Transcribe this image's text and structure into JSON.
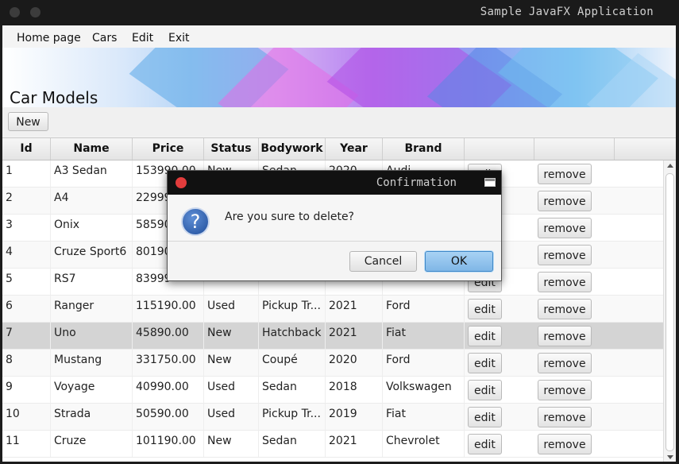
{
  "window": {
    "title": "Sample JavaFX Application"
  },
  "menu": [
    "Home page",
    "Cars",
    "Edit",
    "Exit"
  ],
  "banner": {
    "title": "Car Models"
  },
  "toolbar": {
    "new_label": "New"
  },
  "table": {
    "columns": [
      "Id",
      "Name",
      "Price",
      "Status",
      "Bodywork",
      "Year",
      "Brand",
      "",
      ""
    ],
    "edit_label": "edit",
    "remove_label": "remove",
    "rows": [
      {
        "id": "1",
        "name": "A3 Sedan",
        "price": "153990.00",
        "status": "New",
        "bodywork": "Sedan",
        "year": "2020",
        "brand": "Audi"
      },
      {
        "id": "2",
        "name": "A4",
        "price": "22999",
        "status": "",
        "bodywork": "",
        "year": "",
        "brand": ""
      },
      {
        "id": "3",
        "name": "Onix",
        "price": "58590",
        "status": "",
        "bodywork": "",
        "year": "",
        "brand": ""
      },
      {
        "id": "4",
        "name": "Cruze Sport6",
        "price": "80190",
        "status": "",
        "bodywork": "",
        "year": "",
        "brand": ""
      },
      {
        "id": "5",
        "name": "RS7",
        "price": "83999",
        "status": "",
        "bodywork": "",
        "year": "",
        "brand": ""
      },
      {
        "id": "6",
        "name": "Ranger",
        "price": "115190.00",
        "status": "Used",
        "bodywork": "Pickup Tr...",
        "year": "2021",
        "brand": "Ford"
      },
      {
        "id": "7",
        "name": "Uno",
        "price": "45890.00",
        "status": "New",
        "bodywork": "Hatchback",
        "year": "2021",
        "brand": "Fiat"
      },
      {
        "id": "8",
        "name": "Mustang",
        "price": "331750.00",
        "status": "New",
        "bodywork": "Coupé",
        "year": "2020",
        "brand": "Ford"
      },
      {
        "id": "9",
        "name": "Voyage",
        "price": "40990.00",
        "status": "Used",
        "bodywork": "Sedan",
        "year": "2018",
        "brand": "Volkswagen"
      },
      {
        "id": "10",
        "name": "Strada",
        "price": "50590.00",
        "status": "Used",
        "bodywork": "Pickup Tr...",
        "year": "2019",
        "brand": "Fiat"
      },
      {
        "id": "11",
        "name": "Cruze",
        "price": "101190.00",
        "status": "New",
        "bodywork": "Sedan",
        "year": "2021",
        "brand": "Chevrolet"
      }
    ],
    "selected_row": 7
  },
  "dialog": {
    "title": "Confirmation",
    "icon": "question-icon",
    "message": "Are you sure to delete?",
    "cancel_label": "Cancel",
    "ok_label": "OK"
  },
  "colors": {
    "accent": "#7fb6e6",
    "selected_row": "#d4d4d4",
    "close_button": "#e23c3c"
  }
}
